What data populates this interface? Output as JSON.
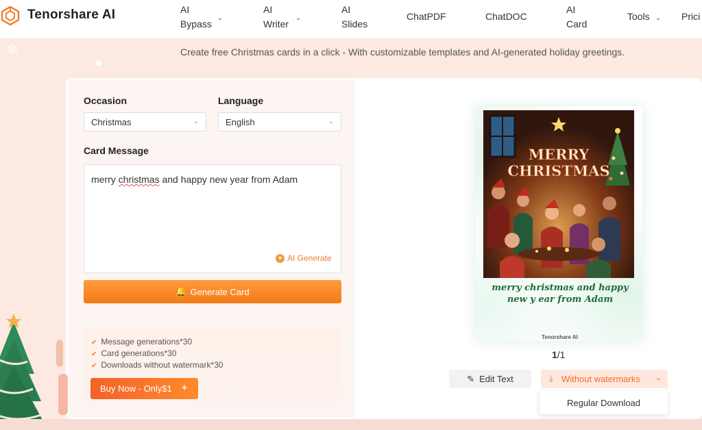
{
  "brand": {
    "name": "Tenorshare AI",
    "logo_icon": "hexagon-logo-icon"
  },
  "nav": {
    "items": [
      {
        "line1": "AI",
        "line2": "Bypass",
        "has_dropdown": true
      },
      {
        "line1": "AI",
        "line2": "Writer",
        "has_dropdown": true
      },
      {
        "line1": "AI",
        "line2": "Slides",
        "has_dropdown": false
      },
      {
        "line1": "ChatPDF",
        "line2": "",
        "has_dropdown": false
      },
      {
        "line1": "ChatDOC",
        "line2": "",
        "has_dropdown": false
      },
      {
        "line1": "AI",
        "line2": "Card",
        "has_dropdown": false
      },
      {
        "line1": "Tools",
        "line2": "",
        "has_dropdown": true
      },
      {
        "line1": "Prici",
        "line2": "",
        "has_dropdown": false
      }
    ]
  },
  "tagline": "Create free Christmas cards in a click - With customizable templates and AI-generated holiday greetings.",
  "form": {
    "occasion_label": "Occasion",
    "occasion_value": "Christmas",
    "language_label": "Language",
    "language_value": "English",
    "message_label": "Card Message",
    "message_before": "merry ",
    "message_misspelled": "christmas",
    "message_after": " and happy new year from Adam",
    "ai_generate_label": "AI Generate",
    "generate_button": "Generate Card"
  },
  "perks": {
    "items": [
      "Message generations*30",
      "Card generations*30",
      "Downloads without watermark*30"
    ],
    "buy_button": "Buy Now - Only$1"
  },
  "preview": {
    "image_title_line1": "MERRY",
    "image_title_line2": "CHRISTMAS",
    "card_message": "merry christmas and happy new y ear from Adam",
    "watermark": "Tenorshare AI",
    "page_current": "1",
    "page_total": "/1",
    "edit_text_button": "Edit Text",
    "download_button": "Without watermarks",
    "download_option": "Regular Download"
  },
  "colors": {
    "accent": "#f27b15",
    "page_bg": "#fbe9e2",
    "card_text_green": "#1e6b34"
  }
}
